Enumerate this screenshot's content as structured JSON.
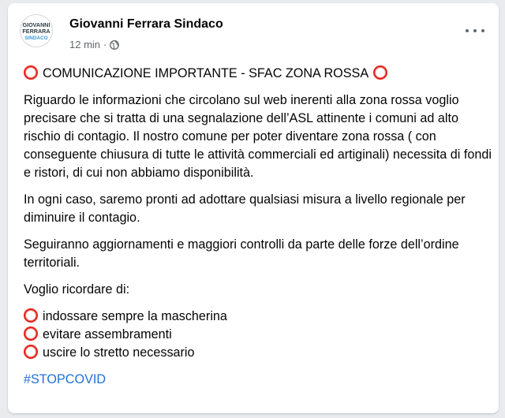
{
  "post": {
    "author": "Giovanni Ferrara Sindaco",
    "timestamp": "12 min",
    "separator": "·",
    "privacy_icon": "globe-icon",
    "avatar_text": {
      "line1": "GIOVANNI",
      "line2": "FERRARA",
      "line3": "SINDACO"
    },
    "more_icon": "more-horizontal-icon",
    "headline": "COMUNICAZIONE IMPORTANTE - SFAC ZONA ROSSA",
    "paragraphs": [
      "Riguardo le informazioni che circolano sul web inerenti alla zona rossa voglio precisare che si tratta di una segnalazione dell’ASL attinente i comuni ad alto rischio di contagio. Il nostro comune per poter diventare zona rossa ( con conseguente chiusura di tutte le attività commerciali ed artiginali) necessita di fondi e ristori, di cui non abbiamo disponibilità.",
      "In ogni caso, saremo pronti ad adottare qualsiasi misura a livello regionale per diminuire il contagio.",
      "Seguiranno aggiornamenti e maggiori controlli da parte delle forze dell’ordine territoriali.",
      "Voglio ricordare di:"
    ],
    "list_items": [
      "indossare sempre la mascherina",
      "evitare assembramenti",
      "uscire lo stretto necessario"
    ],
    "hashtag": "#STOPCOVID",
    "emoji_icon": "red-circle-icon"
  },
  "colors": {
    "background": "#e9ebee",
    "card": "#ffffff",
    "text": "#050505",
    "meta_text": "#65676b",
    "link": "#216fdb",
    "emoji_red": "#e2231a",
    "avatar_dark": "#2f3b45",
    "avatar_blue": "#3b9ad9"
  }
}
